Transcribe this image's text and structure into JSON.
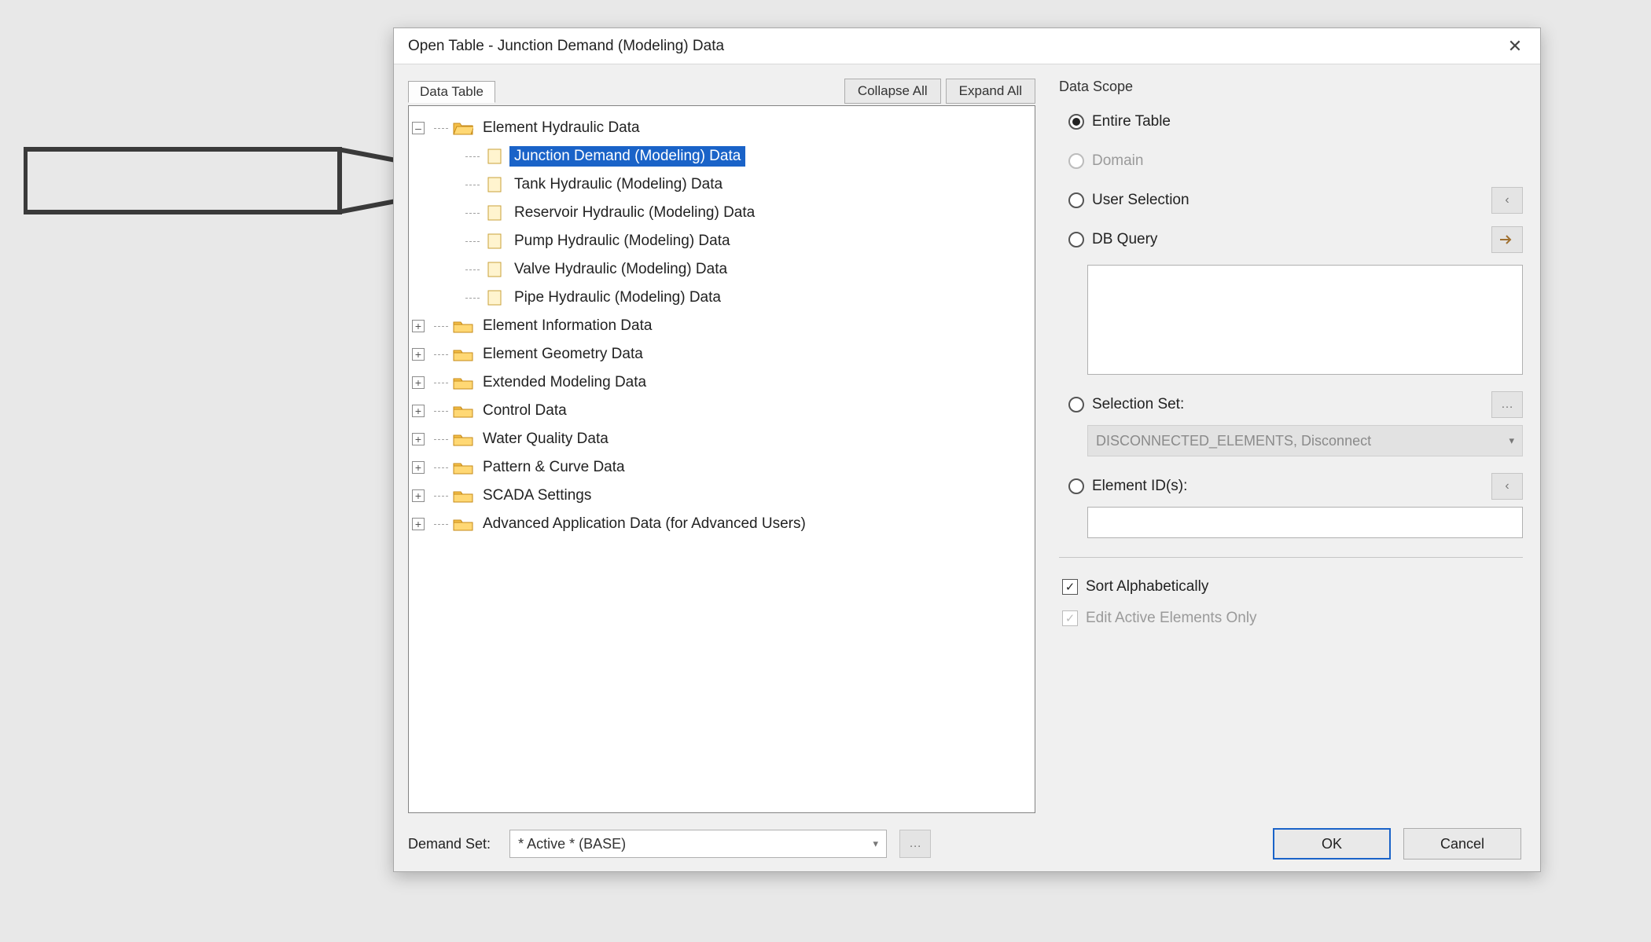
{
  "dialog": {
    "title": "Open Table - Junction Demand (Modeling) Data",
    "tab_label": "Data Table",
    "collapse_btn": "Collapse All",
    "expand_btn": "Expand All"
  },
  "tree": {
    "root": {
      "label": "Element Hydraulic Data"
    },
    "children": [
      {
        "label": "Junction Demand (Modeling) Data",
        "selected": true
      },
      {
        "label": "Tank Hydraulic (Modeling) Data"
      },
      {
        "label": "Reservoir Hydraulic (Modeling) Data"
      },
      {
        "label": "Pump Hydraulic (Modeling) Data"
      },
      {
        "label": "Valve Hydraulic (Modeling) Data"
      },
      {
        "label": "Pipe Hydraulic (Modeling) Data"
      }
    ],
    "siblings": [
      {
        "label": "Element Information Data"
      },
      {
        "label": "Element Geometry Data"
      },
      {
        "label": "Extended Modeling Data"
      },
      {
        "label": "Control Data"
      },
      {
        "label": "Water Quality Data"
      },
      {
        "label": "Pattern & Curve Data"
      },
      {
        "label": "SCADA Settings"
      },
      {
        "label": "Advanced Application Data (for Advanced Users)"
      }
    ]
  },
  "scope": {
    "title": "Data Scope",
    "entire": "Entire Table",
    "domain": "Domain",
    "user_sel": "User Selection",
    "db_query": "DB Query",
    "sel_set": "Selection Set:",
    "sel_set_value": "DISCONNECTED_ELEMENTS, Disconnect",
    "elem_ids": "Element ID(s):",
    "sort": "Sort Alphabetically",
    "edit_active": "Edit Active Elements Only"
  },
  "footer": {
    "demand_set_label": "Demand Set:",
    "demand_set_value": "* Active * (BASE)",
    "ok": "OK",
    "cancel": "Cancel"
  }
}
